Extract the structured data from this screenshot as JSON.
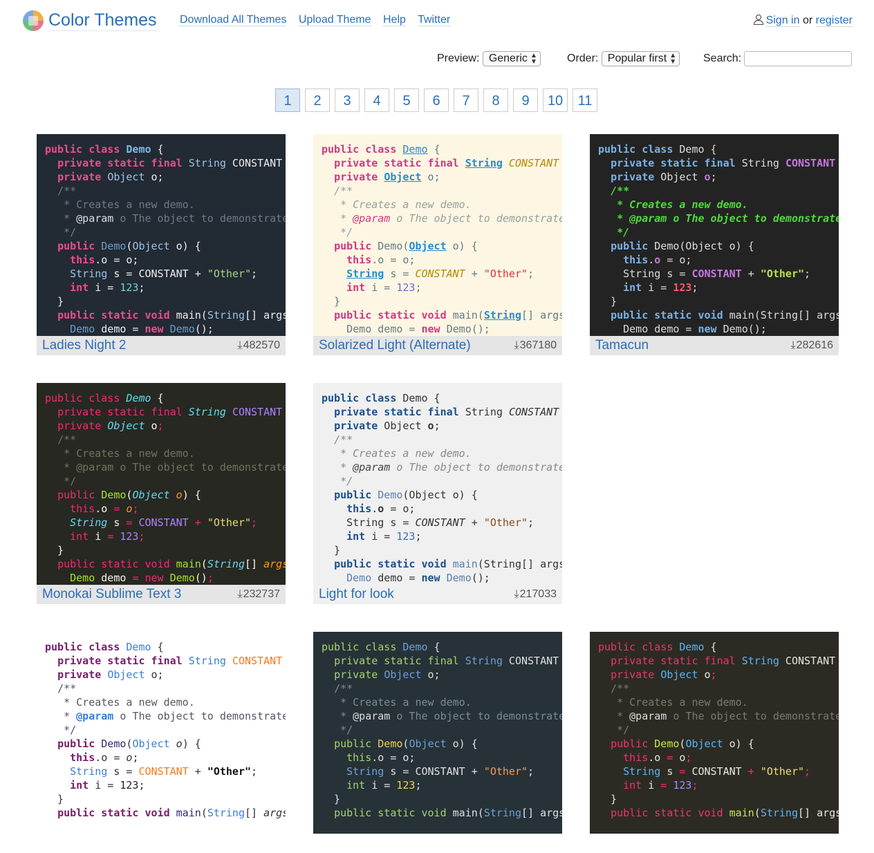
{
  "header": {
    "brand": "Color Themes",
    "nav": [
      "Download All Themes",
      "Upload Theme",
      "Help",
      "Twitter"
    ],
    "sign_in": "Sign in",
    "or": "or",
    "register": "register"
  },
  "controls": {
    "preview_label": "Preview:",
    "preview_value": "Generic",
    "order_label": "Order:",
    "order_value": "Popular first",
    "search_label": "Search:",
    "search_value": ""
  },
  "pagination": {
    "pages": [
      "1",
      "2",
      "3",
      "4",
      "5",
      "6",
      "7",
      "8",
      "9",
      "10",
      "11"
    ],
    "active": "1"
  },
  "themes": [
    {
      "name": "Ladies Night 2",
      "downloads": "482570"
    },
    {
      "name": "Solarized Light (Alternate)",
      "downloads": "367180"
    },
    {
      "name": "Tamacun",
      "downloads": "282616"
    },
    {
      "name": "Monokai Sublime Text 3",
      "downloads": "232737"
    },
    {
      "name": "Light for look",
      "downloads": "217033"
    },
    {
      "name": "",
      "downloads": ""
    },
    {
      "name": "",
      "downloads": ""
    },
    {
      "name": "",
      "downloads": ""
    }
  ],
  "code_sample": {
    "l1": "public class Demo {",
    "l2": "  private static final String CONSTANT = \"String\";",
    "l3": "  private Object o;",
    "l4": "  /**",
    "l5": "   * Creates a new demo.",
    "l6": "   * @param o The object to demonstrate.",
    "l7": "   */",
    "l8": "  public Demo(Object o) {",
    "l9": "    this.o = o;",
    "l10": "    String s = CONSTANT + \"Other\";",
    "l11": "    int i = 123;",
    "l12": "  }",
    "l13": "  public static void main(String[] args) {",
    "l14": "    Demo demo = new Demo();"
  },
  "colors": {
    "link": "#2a6eb8",
    "active_page_bg": "#dce9f5",
    "footer_bg": "#e5e5e5"
  }
}
